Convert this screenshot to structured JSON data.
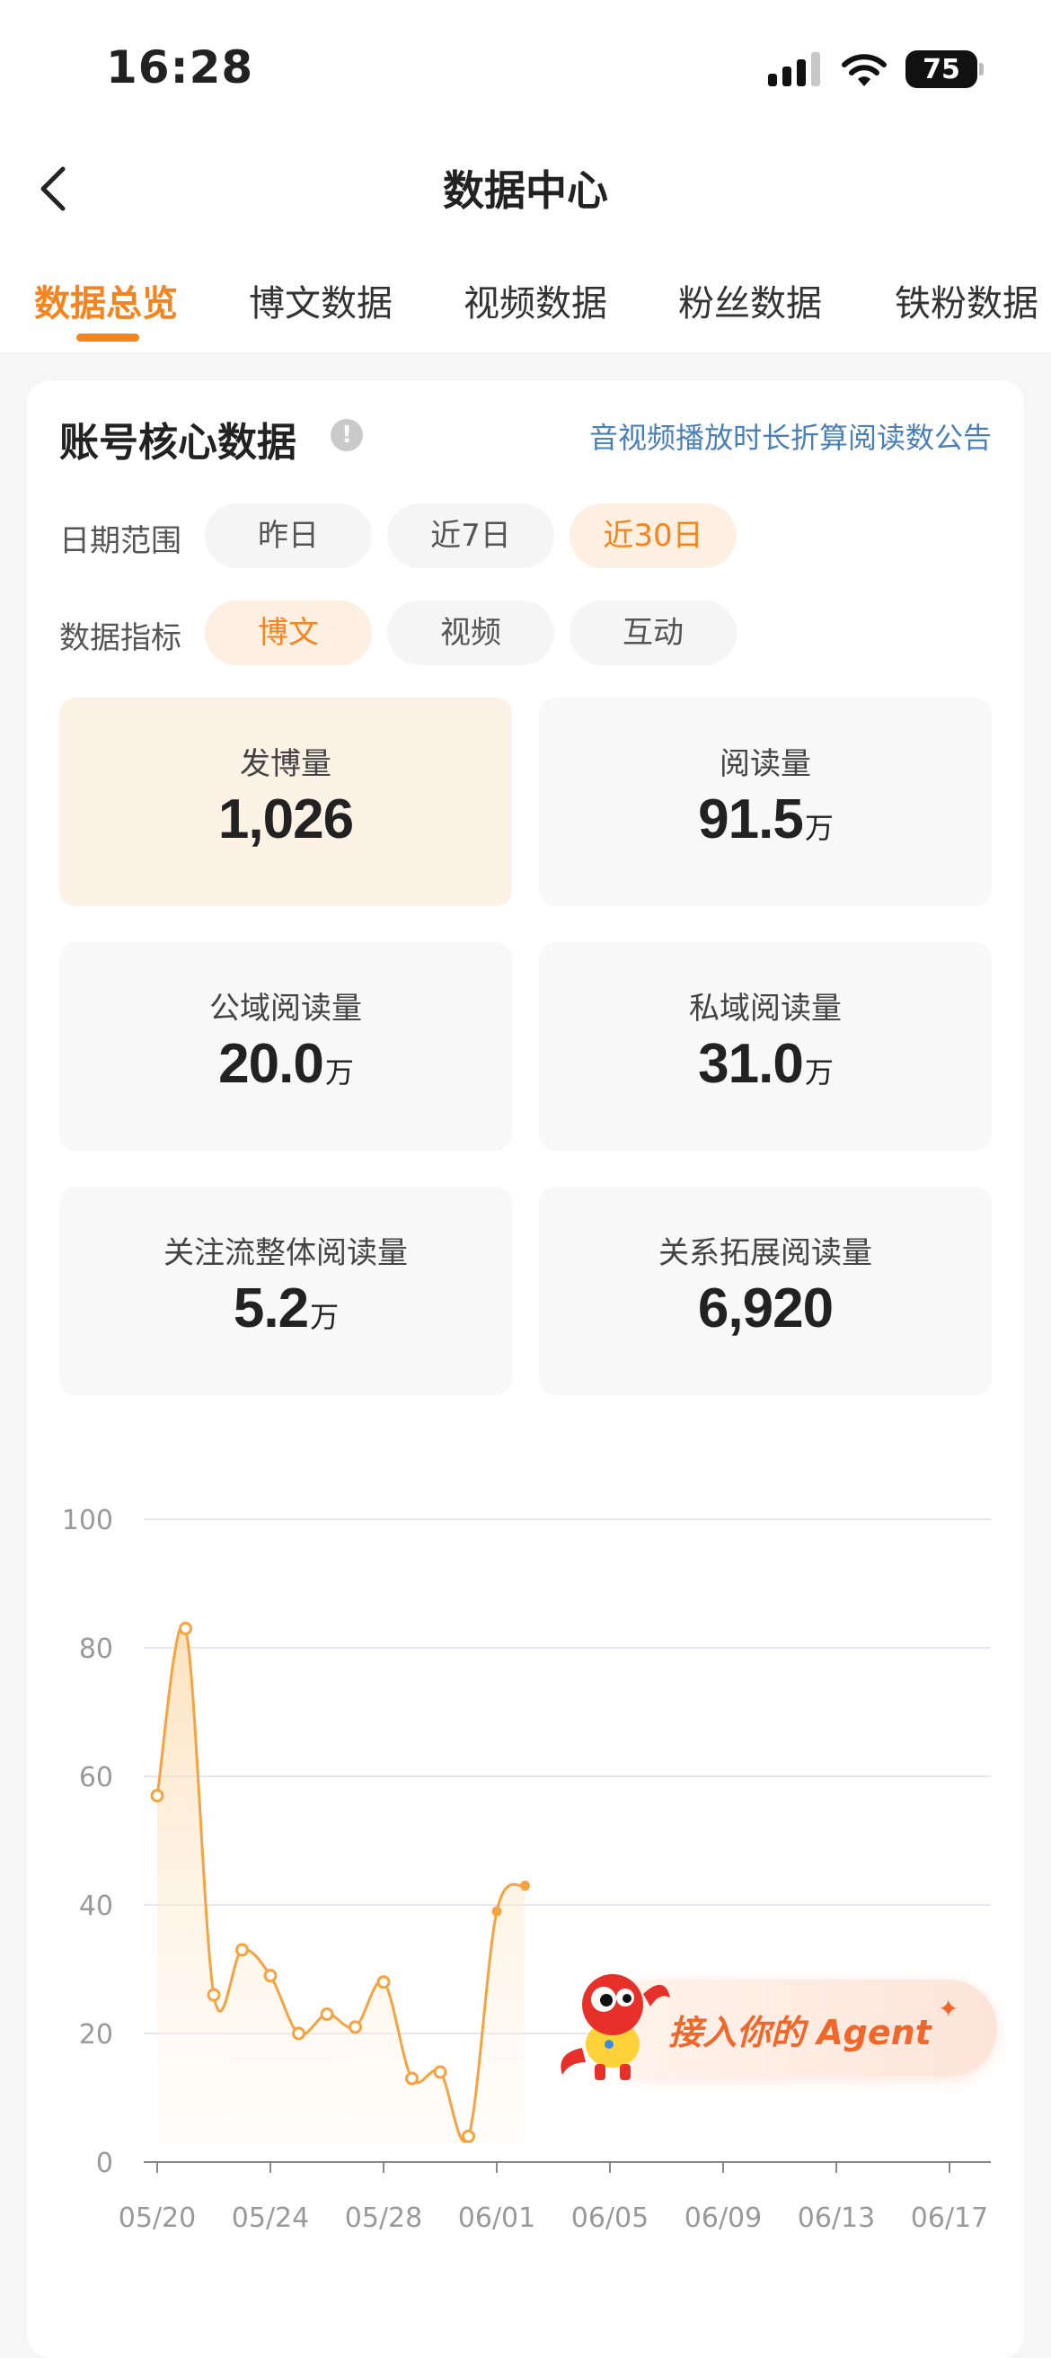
{
  "status_bar": {
    "time": "16:28",
    "battery": "75"
  },
  "nav": {
    "title": "数据中心"
  },
  "tabs": [
    {
      "label": "数据总览",
      "active": true
    },
    {
      "label": "博文数据",
      "active": false
    },
    {
      "label": "视频数据",
      "active": false
    },
    {
      "label": "粉丝数据",
      "active": false
    },
    {
      "label": "铁粉数据",
      "active": false
    }
  ],
  "card": {
    "title": "账号核心数据",
    "info_icon": "!",
    "notice_link": "音视频播放时长折算阅读数公告",
    "date_range": {
      "label": "日期范围",
      "options": [
        "昨日",
        "近7日",
        "近30日"
      ],
      "selected": "近30日"
    },
    "metric_type": {
      "label": "数据指标",
      "options": [
        "博文",
        "视频",
        "互动"
      ],
      "selected": "博文"
    },
    "metrics": [
      {
        "label": "发博量",
        "value": "1,026",
        "unit": ""
      },
      {
        "label": "阅读量",
        "value": "91.5",
        "unit": "万"
      },
      {
        "label": "公域阅读量",
        "value": "20.0",
        "unit": "万"
      },
      {
        "label": "私域阅读量",
        "value": "31.0",
        "unit": "万"
      },
      {
        "label": "关注流整体阅读量",
        "value": "5.2",
        "unit": "万"
      },
      {
        "label": "关系拓展阅读量",
        "value": "6,920",
        "unit": ""
      }
    ]
  },
  "agent_banner": {
    "text": "接入你的 Agent",
    "spark": "✦"
  },
  "colors": {
    "accent": "#f5841f",
    "link": "#4a7fb8",
    "line": "#f5a340"
  },
  "chart_data": {
    "type": "area",
    "title": "",
    "xlabel": "",
    "ylabel": "",
    "ylim": [
      0,
      100
    ],
    "yticks": [
      0,
      20,
      40,
      60,
      80,
      100
    ],
    "xtick_labels": [
      "05/20",
      "05/24",
      "05/28",
      "06/01",
      "06/05",
      "06/09",
      "06/13",
      "06/17"
    ],
    "x": [
      "05/20",
      "05/21",
      "05/22",
      "05/23",
      "05/24",
      "05/25",
      "05/26",
      "05/27",
      "05/28",
      "05/29",
      "05/30",
      "05/31",
      "06/01",
      "06/02"
    ],
    "series": [
      {
        "values": [
          57,
          83,
          26,
          33,
          29,
          20,
          23,
          21,
          28,
          13,
          14,
          4,
          39,
          43
        ]
      }
    ],
    "grid": true
  }
}
